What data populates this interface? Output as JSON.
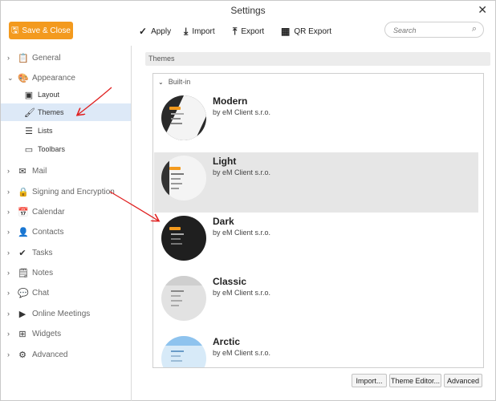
{
  "window": {
    "title": "Settings",
    "close_glyph": "✕"
  },
  "toolbar": {
    "save_close": "Save & Close",
    "apply": "Apply",
    "import": "Import",
    "export": "Export",
    "qr_export": "QR Export",
    "search_placeholder": "Search"
  },
  "sidebar": {
    "items": [
      {
        "label": "General",
        "icon": "clipboard-icon"
      },
      {
        "label": "Appearance",
        "icon": "palette-icon",
        "expanded": true
      },
      {
        "label": "Layout",
        "icon": "layout-icon"
      },
      {
        "label": "Themes",
        "icon": "brush-icon",
        "selected": true
      },
      {
        "label": "Lists",
        "icon": "list-icon"
      },
      {
        "label": "Toolbars",
        "icon": "toolbar-icon"
      },
      {
        "label": "Mail",
        "icon": "mail-icon"
      },
      {
        "label": "Signing and Encryption",
        "icon": "lock-icon"
      },
      {
        "label": "Calendar",
        "icon": "calendar-icon"
      },
      {
        "label": "Contacts",
        "icon": "contact-icon"
      },
      {
        "label": "Tasks",
        "icon": "check-icon"
      },
      {
        "label": "Notes",
        "icon": "notes-icon"
      },
      {
        "label": "Chat",
        "icon": "chat-icon"
      },
      {
        "label": "Online Meetings",
        "icon": "video-icon"
      },
      {
        "label": "Widgets",
        "icon": "widgets-icon"
      },
      {
        "label": "Advanced",
        "icon": "gear-icon"
      }
    ]
  },
  "content": {
    "section_title": "Themes",
    "group_title": "Built-in",
    "themes": [
      {
        "name": "Modern",
        "author": "by eM Client s.r.o.",
        "bg": "#2a2a2a",
        "alt": "#f4f4f4"
      },
      {
        "name": "Light",
        "author": "by eM Client s.r.o.",
        "bg": "#f4f4f4",
        "alt": "#333333",
        "selected": true
      },
      {
        "name": "Dark",
        "author": "by eM Client s.r.o.",
        "bg": "#1f1f1f",
        "alt": "#1f1f1f"
      },
      {
        "name": "Classic",
        "author": "by eM Client s.r.o.",
        "bg": "#e2e2e2",
        "alt": "#e2e2e2"
      },
      {
        "name": "Arctic",
        "author": "by eM Client s.r.o.",
        "bg": "#d7eaf8",
        "alt": "#d7eaf8"
      }
    ],
    "buttons": {
      "import": "Import...",
      "theme_editor": "Theme Editor...",
      "advanced": "Advanced"
    }
  },
  "colors": {
    "accent": "#f39a1e",
    "selection": "#dde9f7",
    "annotation": "#e02020"
  }
}
